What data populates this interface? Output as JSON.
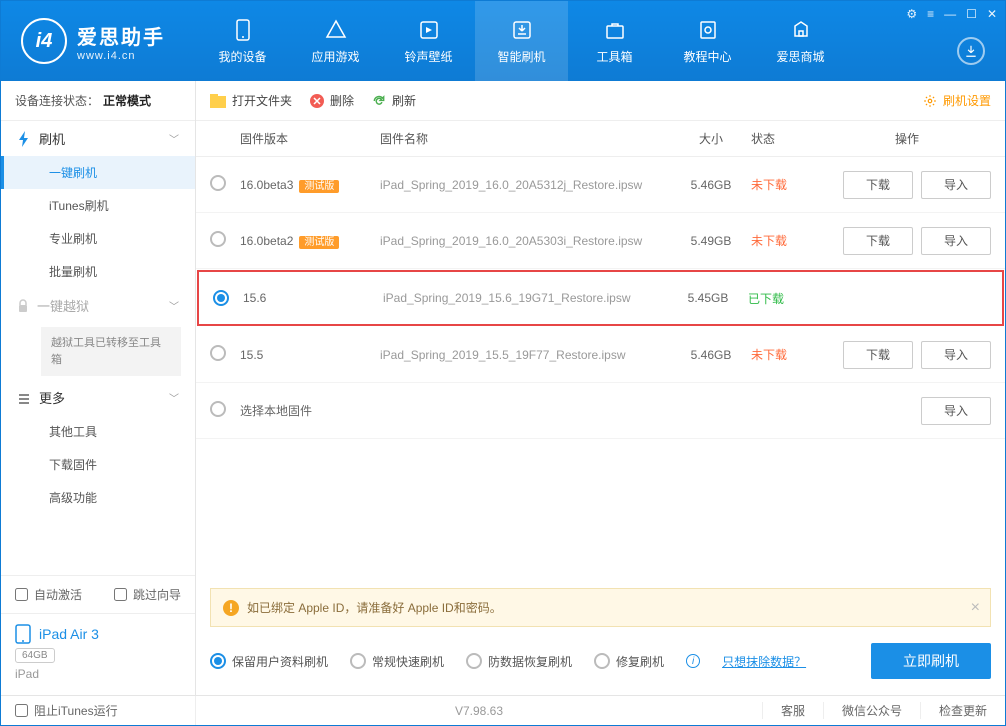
{
  "app": {
    "name": "爱思助手",
    "url": "www.i4.cn",
    "logo_letter": "i4"
  },
  "window_controls": [
    "⚙",
    "≡",
    "—",
    "☐",
    "✕"
  ],
  "nav": [
    {
      "label": "我的设备"
    },
    {
      "label": "应用游戏"
    },
    {
      "label": "铃声壁纸"
    },
    {
      "label": "智能刷机",
      "active": true
    },
    {
      "label": "工具箱"
    },
    {
      "label": "教程中心"
    },
    {
      "label": "爱思商城"
    }
  ],
  "sidebar": {
    "status_label": "设备连接状态：",
    "status_value": "正常模式",
    "sections": [
      {
        "head": "刷机",
        "icon": "flash",
        "items": [
          "一键刷机",
          "iTunes刷机",
          "专业刷机",
          "批量刷机"
        ],
        "active_index": 0
      },
      {
        "head": "一键越狱",
        "icon": "lock",
        "locked": true,
        "note": "越狱工具已转移至工具箱"
      },
      {
        "head": "更多",
        "icon": "more",
        "items": [
          "其他工具",
          "下载固件",
          "高级功能"
        ]
      }
    ],
    "auto_activate": "自动激活",
    "skip_wizard": "跳过向导",
    "device": {
      "name": "iPad Air 3",
      "capacity": "64GB",
      "model": "iPad"
    }
  },
  "toolbar": {
    "open_folder": "打开文件夹",
    "delete": "删除",
    "refresh": "刷新",
    "settings": "刷机设置"
  },
  "table": {
    "headers": {
      "version": "固件版本",
      "name": "固件名称",
      "size": "大小",
      "status": "状态",
      "ops": "操作"
    },
    "rows": [
      {
        "version": "16.0beta3",
        "beta": "测试版",
        "name": "iPad_Spring_2019_16.0_20A5312j_Restore.ipsw",
        "size": "5.46GB",
        "status": "未下载",
        "status_type": "und",
        "download": "下载",
        "import": "导入"
      },
      {
        "version": "16.0beta2",
        "beta": "测试版",
        "name": "iPad_Spring_2019_16.0_20A5303i_Restore.ipsw",
        "size": "5.49GB",
        "status": "未下载",
        "status_type": "und",
        "download": "下载",
        "import": "导入"
      },
      {
        "version": "15.6",
        "name": "iPad_Spring_2019_15.6_19G71_Restore.ipsw",
        "size": "5.45GB",
        "status": "已下载",
        "status_type": "done",
        "selected": true,
        "highlight": true
      },
      {
        "version": "15.5",
        "name": "iPad_Spring_2019_15.5_19F77_Restore.ipsw",
        "size": "5.46GB",
        "status": "未下载",
        "status_type": "und",
        "download": "下载",
        "import": "导入"
      },
      {
        "version": "选择本地固件",
        "local": true,
        "import": "导入"
      }
    ]
  },
  "warning": "如已绑定 Apple ID，请准备好 Apple ID和密码。",
  "options": {
    "opts": [
      "保留用户资料刷机",
      "常规快速刷机",
      "防数据恢复刷机",
      "修复刷机"
    ],
    "selected_index": 0,
    "erase_link": "只想抹除数据？",
    "flash_btn": "立即刷机"
  },
  "footer": {
    "block_itunes": "阻止iTunes运行",
    "version": "V7.98.63",
    "links": [
      "客服",
      "微信公众号",
      "检查更新"
    ]
  }
}
